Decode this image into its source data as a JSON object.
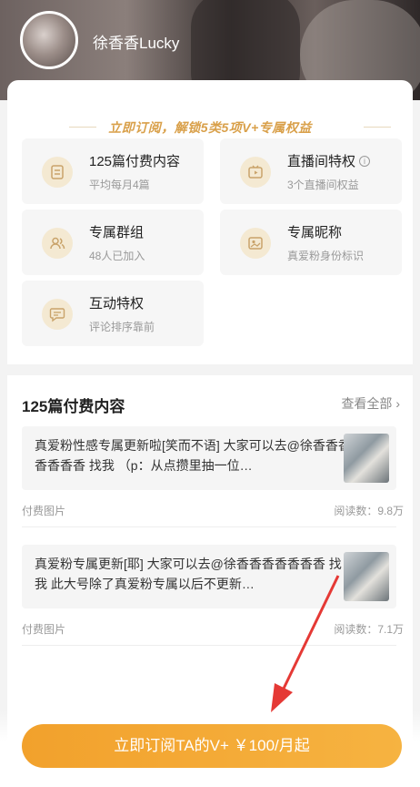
{
  "header": {
    "username": "徐香香Lucky"
  },
  "subscribe_banner": {
    "slogan": "立即订阅，解锁5类5项V+专属权益"
  },
  "privileges": [
    {
      "title": "125篇付费内容",
      "sub": "平均每月4篇",
      "icon": "document-icon"
    },
    {
      "title": "直播间特权",
      "sub": "3个直播间权益",
      "icon": "live-tv-icon",
      "info": "i"
    },
    {
      "title": "专属群组",
      "sub": "48人已加入",
      "icon": "group-icon"
    },
    {
      "title": "专属昵称",
      "sub": "真爱粉身份标识",
      "icon": "nickname-card-icon"
    },
    {
      "title": "互动特权",
      "sub": "评论排序靠前",
      "icon": "comment-icon"
    }
  ],
  "paid_content": {
    "title": "125篇付费内容",
    "see_all": "查看全部 ›",
    "items": [
      {
        "text": "真爱粉性感专属更新啦[笑而不语] 大家可以去@徐香香香香香香香 找我 （p：从点攒里抽一位…",
        "type": "付费图片",
        "reads": "阅读数：9.8万"
      },
      {
        "text": "真爱粉专属更新[耶] 大家可以去@徐香香香香香香香 找我 此大号除了真爱粉专属以后不更新…",
        "type": "付费图片",
        "reads": "阅读数：7.1万"
      }
    ]
  },
  "cta": {
    "label": "立即订阅TA的V+ ￥100/月起"
  },
  "colors": {
    "accent": "#f2a12c",
    "slogan": "#d9a04a",
    "arrow": "#e53935"
  }
}
